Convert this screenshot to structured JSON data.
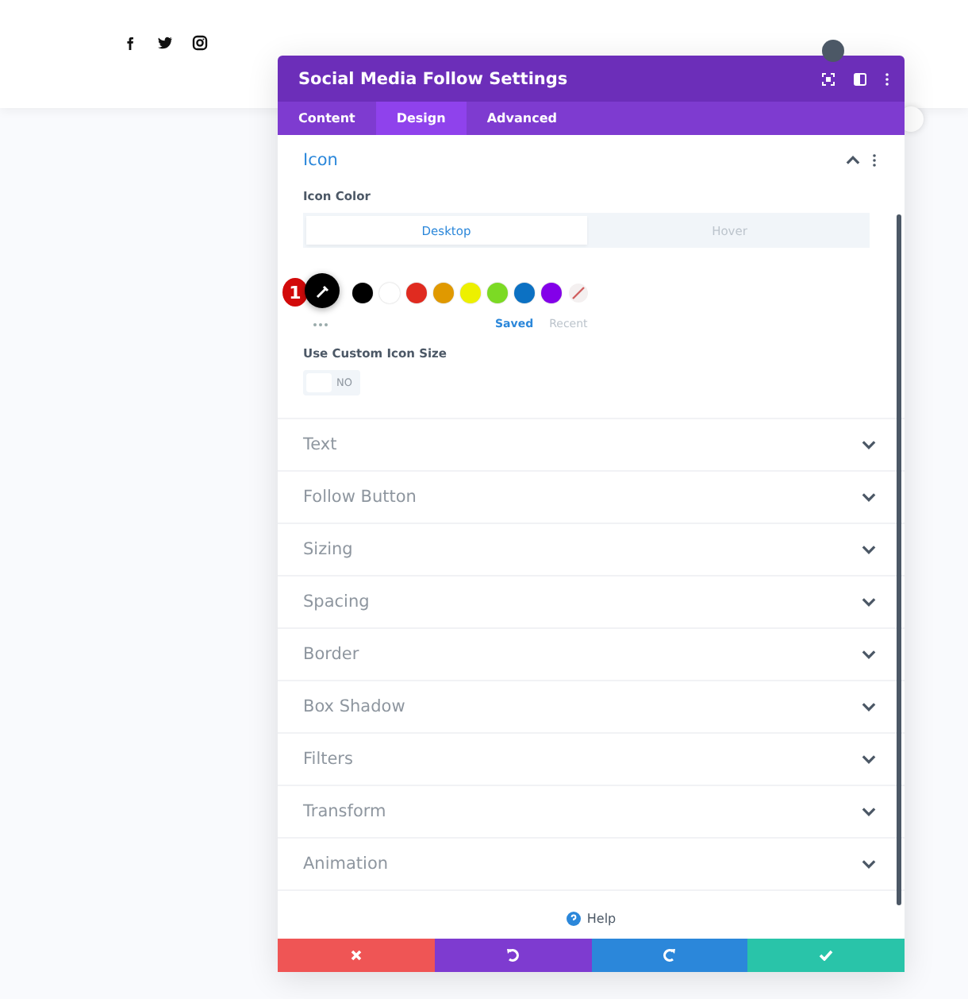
{
  "panel": {
    "title": "Social Media Follow Settings",
    "tabs": [
      {
        "label": "Content",
        "selected": false
      },
      {
        "label": "Design",
        "selected": true
      },
      {
        "label": "Advanced",
        "selected": false
      }
    ],
    "sections": [
      {
        "title": "Icon",
        "expanded": true,
        "field_label": "Icon Color",
        "device_tabs": [
          {
            "label": "Desktop",
            "selected": true
          },
          {
            "label": "Hover",
            "selected": false
          }
        ],
        "badge": "1",
        "swatches": [
          {
            "color": "#000000"
          },
          {
            "color": "#ffffff"
          },
          {
            "color": "#e02b20"
          },
          {
            "color": "#e09900"
          },
          {
            "color": "#edf000"
          },
          {
            "color": "#7cda24"
          },
          {
            "color": "#0c71c3"
          },
          {
            "color": "#8300e9"
          }
        ],
        "palette_tabs": [
          {
            "label": "Saved",
            "selected": true
          },
          {
            "label": "Recent",
            "selected": false
          }
        ],
        "toggle_label": "Use Custom Icon Size",
        "toggle": {
          "label": "NO",
          "on": false
        }
      },
      {
        "title": "Text",
        "expanded": false
      },
      {
        "title": "Follow Button",
        "expanded": false
      },
      {
        "title": "Sizing",
        "expanded": false
      },
      {
        "title": "Spacing",
        "expanded": false
      },
      {
        "title": "Border",
        "expanded": false
      },
      {
        "title": "Box Shadow",
        "expanded": false
      },
      {
        "title": "Filters",
        "expanded": false
      },
      {
        "title": "Transform",
        "expanded": false
      },
      {
        "title": "Animation",
        "expanded": false
      }
    ],
    "help": "Help",
    "footer": [
      {
        "kind": "cancel"
      },
      {
        "kind": "undo"
      },
      {
        "kind": "redo"
      },
      {
        "kind": "save"
      }
    ]
  }
}
